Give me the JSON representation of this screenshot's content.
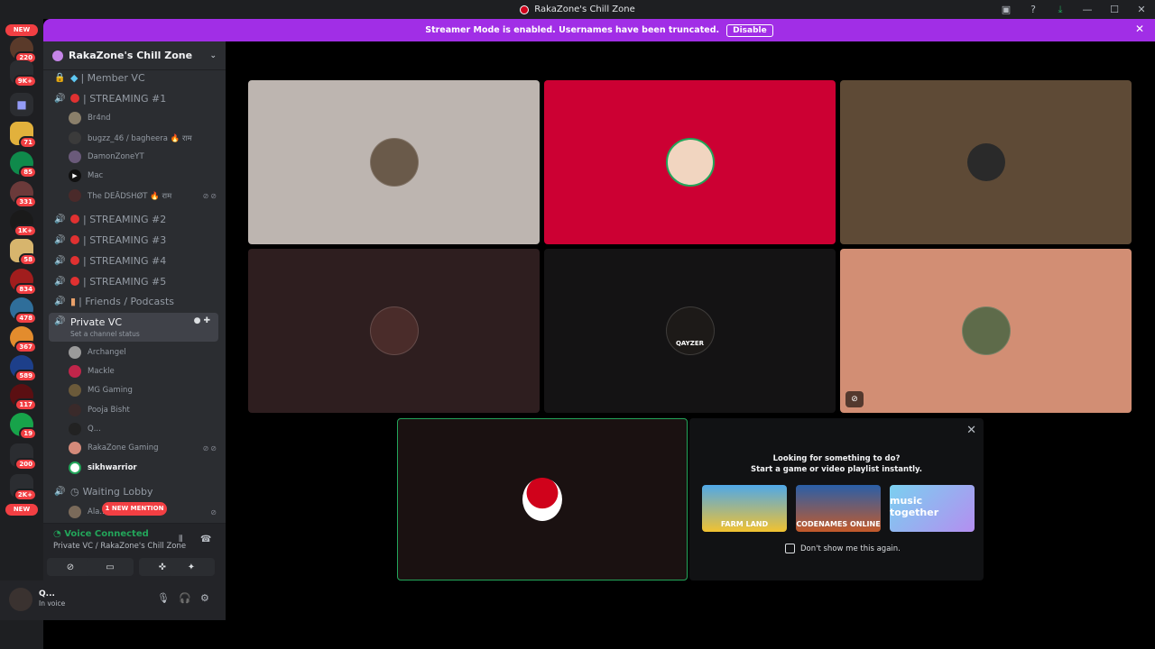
{
  "window": {
    "title": "RakaZone's Chill Zone"
  },
  "banner": {
    "text": "Streamer Mode is enabled. Usernames have been truncated.",
    "button": "Disable"
  },
  "servers": {
    "new_top": "NEW",
    "new_bottom": "NEW",
    "badges": [
      "220",
      "9K+",
      "71",
      "85",
      "331",
      "1K+",
      "58",
      "834",
      "478",
      "367",
      "589",
      "117",
      "19",
      "200",
      "2K+"
    ]
  },
  "guild": {
    "name": "RakaZone's Chill Zone"
  },
  "channels": {
    "member_vc": "| Member VC",
    "streaming1": "| STREAMING #1",
    "streaming2": "| STREAMING #2",
    "streaming3": "| STREAMING #3",
    "streaming4": "| STREAMING #4",
    "streaming5": "| STREAMING #5",
    "friends": "| Friends / Podcasts",
    "private_vc": "Private VC",
    "private_status": "Set a channel status",
    "waiting": "Waiting Lobby"
  },
  "members": {
    "s1": [
      "Br4nd",
      "bugzz_46 / bagheera 🔥 राम",
      "DamonZoneYT",
      "Mac",
      "The DEĀDSHØT 🔥 राम"
    ],
    "pvc": [
      "Archangel",
      "Mackle",
      "MG Gaming",
      "Pooja Bisht",
      "Q...",
      "RakaZone Gaming",
      "sikhwarrior"
    ],
    "lobby": [
      "Ala..."
    ]
  },
  "mention": "1 NEW MENTION",
  "voice": {
    "status": "Voice Connected",
    "channel": "Private VC / RakaZone's Chill Zone"
  },
  "user": {
    "name": "Q...",
    "status": "In voice"
  },
  "tiles": {
    "tile5_text": "QAYZER"
  },
  "activity": {
    "line1": "Looking for something to do?",
    "line2": "Start a game or video playlist instantly.",
    "games": [
      "FARM LAND",
      "CODENAMES ONLINE",
      "music together"
    ],
    "checkbox": "Don't show me this again."
  },
  "colors": {
    "streamer_banner": "#a12ee6",
    "live_dot": "#e03131",
    "connected": "#23a55a",
    "badge": "#f23f43"
  }
}
